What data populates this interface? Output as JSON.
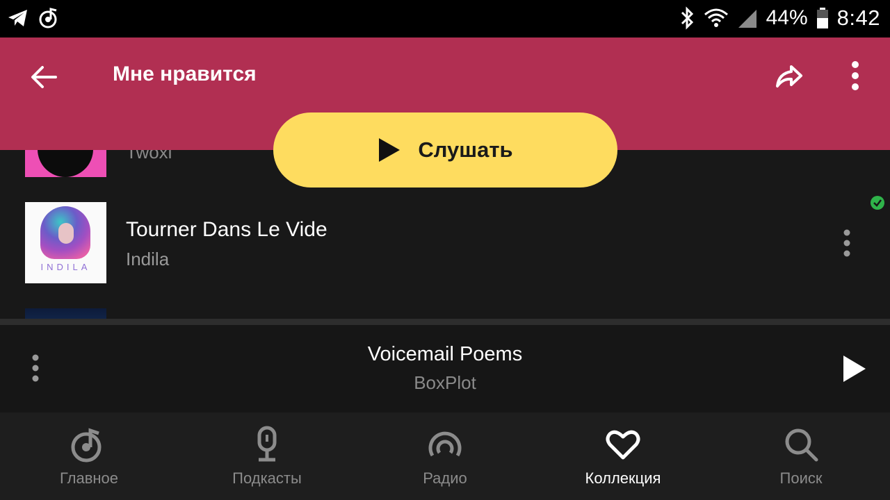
{
  "status_bar": {
    "battery_percent": "44%",
    "time": "8:42",
    "left_icons": [
      "telegram-icon",
      "music-note-icon"
    ],
    "right_icons": [
      "bluetooth-icon",
      "wifi-icon",
      "signal-icon",
      "battery-icon"
    ]
  },
  "header": {
    "title": "Мне нравится",
    "background": "#b12f52"
  },
  "listen_button": {
    "label": "Слушать",
    "color": "#fedc5f"
  },
  "tracks": [
    {
      "title": "",
      "artist": "Twoxi",
      "cover": "pink-cover"
    },
    {
      "title": "Tourner Dans Le Vide",
      "artist": "Indila",
      "cover": "indila-mini-world-cover",
      "cover_text": "INDILA",
      "downloaded": true
    },
    {
      "title": "",
      "artist": "",
      "cover": "blue-cover"
    }
  ],
  "player": {
    "title": "Voicemail Poems",
    "artist": "BoxPlot"
  },
  "bottom_nav": [
    {
      "label": "Главное",
      "icon": "home-vinyl-icon",
      "active": false
    },
    {
      "label": "Подкасты",
      "icon": "microphone-icon",
      "active": false
    },
    {
      "label": "Радио",
      "icon": "radio-icon",
      "active": false
    },
    {
      "label": "Коллекция",
      "icon": "heart-icon",
      "active": true
    },
    {
      "label": "Поиск",
      "icon": "search-icon",
      "active": false
    }
  ],
  "colors": {
    "accent": "#fedc5f",
    "header": "#b12f52",
    "downloaded_check": "#2fb34a"
  }
}
